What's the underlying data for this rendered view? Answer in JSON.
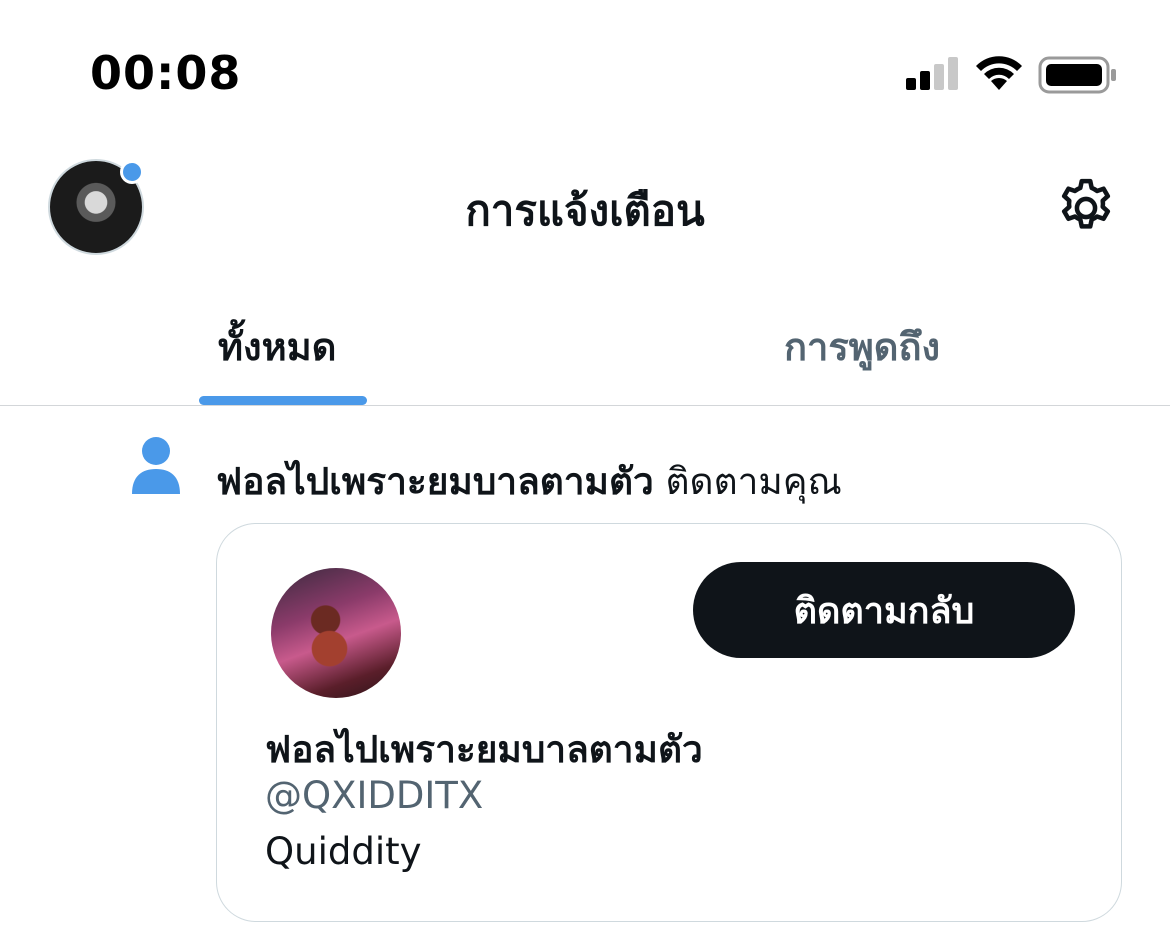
{
  "status_bar": {
    "time": "00:08",
    "signal_icon": "cellular-signal-icon",
    "wifi_icon": "wifi-icon",
    "battery_icon": "battery-icon"
  },
  "header": {
    "title": "การแจ้งเตือน",
    "settings_icon": "gear-icon",
    "avatar_badge_color": "#4a99e9"
  },
  "tabs": [
    {
      "label": "ทั้งหมด",
      "active": true
    },
    {
      "label": "การพูดถึง",
      "active": false
    }
  ],
  "notification": {
    "icon": "person-icon",
    "icon_color": "#4a99e9",
    "actor_name": "ฟอลไปเพราะยมบาลตามตัว",
    "action_text": " ติดตามคุณ",
    "card": {
      "display_name": "ฟอลไปเพราะยมบาลตามตัว",
      "handle": "@QXIDDITX",
      "bio": "Quiddity",
      "follow_back_label": "ติดตามกลับ"
    }
  },
  "colors": {
    "accent": "#4a99e9",
    "text_primary": "#0f1419",
    "text_secondary": "#536471",
    "button_bg": "#0f1419"
  }
}
